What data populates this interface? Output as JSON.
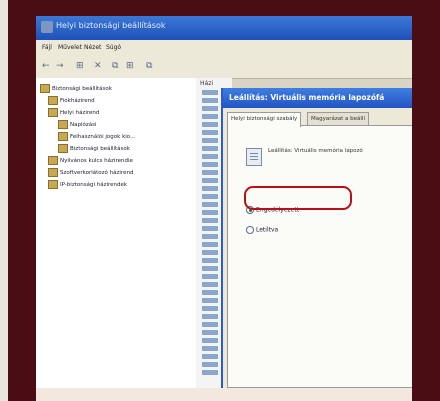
{
  "window": {
    "title": "Helyi biztonsági beállítások"
  },
  "menubar": {
    "items": [
      "Fájl",
      "Művelet",
      "Nézet",
      "Súgó"
    ]
  },
  "toolbar": {
    "buttons": [
      "←",
      "→",
      "⊞",
      "✕",
      "⧉",
      "⊞",
      "⧉"
    ]
  },
  "tree": {
    "items": [
      {
        "label": "Biztonsági beállítások",
        "level": 0
      },
      {
        "label": "Fiókházirend",
        "level": 1
      },
      {
        "label": "Helyi házirend",
        "level": 1
      },
      {
        "label": "Naplózási",
        "level": 2
      },
      {
        "label": "Felhasználói jogok kio…",
        "level": 2
      },
      {
        "label": "Biztonsági beállítások",
        "level": 2
      },
      {
        "label": "Nyilvános kulcs házirendie",
        "level": 1
      },
      {
        "label": "Szoftverkorlátozó házirend",
        "level": 1
      },
      {
        "label": "IP-biztonsági házirendek",
        "level": 1
      }
    ]
  },
  "list": {
    "header": "Házi"
  },
  "dialog": {
    "title": "Leállítás: Virtuális memória lapozófá",
    "tabs": [
      "Helyi biztonsági szabály",
      "Magyarázat a beállí"
    ],
    "description": "Leállítás: Virtuális memória lapozó",
    "options": [
      {
        "label": "Engedélyezett",
        "selected": true
      },
      {
        "label": "Letiltva",
        "selected": false
      }
    ]
  },
  "colors": {
    "frame": "#4a0d14",
    "highlight": "#b8101a",
    "titlebar": "#2254c4"
  }
}
